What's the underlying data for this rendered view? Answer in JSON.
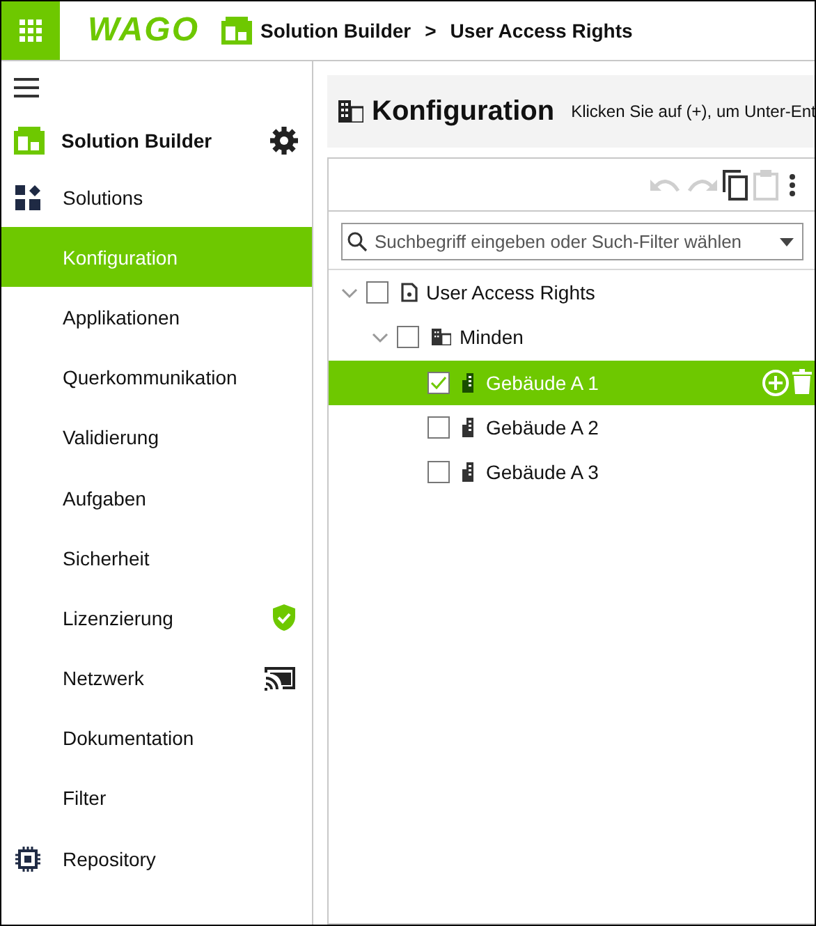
{
  "header": {
    "logo": "WAGO",
    "breadcrumb": [
      "Solution Builder",
      "User Access Rights"
    ],
    "separator": ">"
  },
  "sidebar": {
    "title": "Solution Builder",
    "items": [
      {
        "label": "Solutions",
        "selected": false,
        "kind": "solutions"
      },
      {
        "label": "Konfiguration",
        "selected": true,
        "kind": "plain"
      },
      {
        "label": "Applikationen",
        "selected": false,
        "kind": "plain"
      },
      {
        "label": "Querkommunikation",
        "selected": false,
        "kind": "plain"
      },
      {
        "label": "Validierung",
        "selected": false,
        "kind": "plain"
      },
      {
        "label": "Aufgaben",
        "selected": false,
        "kind": "plain"
      },
      {
        "label": "Sicherheit",
        "selected": false,
        "kind": "plain"
      },
      {
        "label": "Lizenzierung",
        "selected": false,
        "kind": "license"
      },
      {
        "label": "Netzwerk",
        "selected": false,
        "kind": "network"
      },
      {
        "label": "Dokumentation",
        "selected": false,
        "kind": "plain"
      },
      {
        "label": "Filter",
        "selected": false,
        "kind": "plain"
      },
      {
        "label": "Repository",
        "selected": false,
        "kind": "repository"
      }
    ]
  },
  "page": {
    "title": "Konfiguration",
    "hint": "Klicken Sie auf (+), um Unter-Ent"
  },
  "toolbar": {
    "undo_disabled": true,
    "redo_disabled": true,
    "copy_disabled": false,
    "paste_disabled": true
  },
  "search": {
    "placeholder": "Suchbegriff eingeben oder Such-Filter wählen"
  },
  "tree": [
    {
      "label": "User Access Rights",
      "kind": "project",
      "expanded": true,
      "checked": false,
      "selected": false,
      "children": [
        {
          "label": "Minden",
          "kind": "site",
          "expanded": true,
          "checked": false,
          "selected": false,
          "children": [
            {
              "label": "Gebäude A 1",
              "kind": "building",
              "checked": true,
              "selected": true
            },
            {
              "label": "Gebäude A 2",
              "kind": "building",
              "checked": false,
              "selected": false
            },
            {
              "label": "Gebäude A 3",
              "kind": "building",
              "checked": false,
              "selected": false
            }
          ]
        }
      ]
    }
  ]
}
